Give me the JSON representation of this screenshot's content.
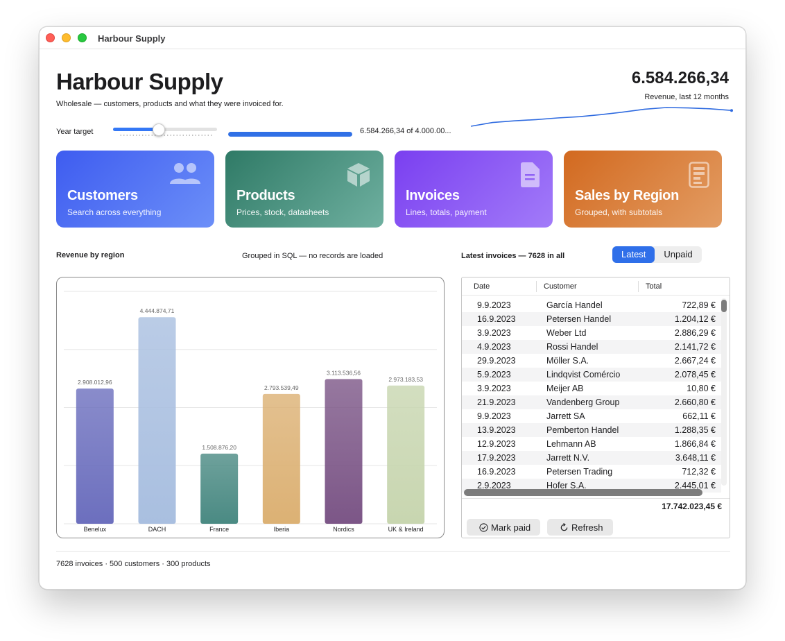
{
  "window": {
    "title": "Harbour Supply"
  },
  "header": {
    "title": "Harbour Supply",
    "subtitle": "Wholesale — customers, products and what they were invoiced for.",
    "revenue_value": "6.584.266,34",
    "revenue_caption": "Revenue, last 12 months"
  },
  "target": {
    "label": "Year target",
    "slider_level": 0.44,
    "progress_fraction": 1.0,
    "progress_text": "6.584.266,34 of 4.000.00..."
  },
  "sparkline": [
    0.1,
    0.28,
    0.36,
    0.42,
    0.5,
    0.56,
    0.66,
    0.78,
    0.92,
    1.0,
    0.98,
    0.94,
    0.86
  ],
  "cards": [
    {
      "title": "Customers",
      "subtitle": "Search across everything",
      "icon": "people-icon"
    },
    {
      "title": "Products",
      "subtitle": "Prices, stock, datasheets",
      "icon": "box-icon"
    },
    {
      "title": "Invoices",
      "subtitle": "Lines, totals, payment",
      "icon": "document-icon"
    },
    {
      "title": "Sales by Region",
      "subtitle": "Grouped, with subtotals",
      "icon": "report-icon"
    }
  ],
  "region_section": {
    "label": "Revenue by region",
    "note": "Grouped in SQL — no records are loaded"
  },
  "chart_data": {
    "type": "bar",
    "categories": [
      "Benelux",
      "DACH",
      "France",
      "Iberia",
      "Nordics",
      "UK & Ireland"
    ],
    "values": [
      2908012.96,
      4444874.71,
      1508876.2,
      2793539.49,
      3113536.56,
      2973183.53
    ],
    "value_labels": [
      "2.908.012,96",
      "4.444.874,71",
      "1.508.876,20",
      "2.793.539,49",
      "3.113.536,56",
      "2.973.183,53"
    ],
    "ylim": [
      0,
      5000000
    ],
    "grid": true,
    "colors": [
      "#6c6fbe",
      "#a9bfe0",
      "#4a8a83",
      "#dcb174",
      "#7c5687",
      "#c8d6b0"
    ]
  },
  "invoices": {
    "label": "Latest invoices — 7628 in all",
    "segments": [
      "Latest",
      "Unpaid"
    ],
    "active_segment": "Latest",
    "columns": [
      "Date",
      "Customer",
      "Total"
    ],
    "rows": [
      [
        "9.9.2023",
        "García Handel",
        "722,89 €"
      ],
      [
        "16.9.2023",
        "Petersen Handel",
        "1.204,12 €"
      ],
      [
        "3.9.2023",
        "Weber Ltd",
        "2.886,29 €"
      ],
      [
        "4.9.2023",
        "Rossi Handel",
        "2.141,72 €"
      ],
      [
        "29.9.2023",
        "Möller S.A.",
        "2.667,24 €"
      ],
      [
        "5.9.2023",
        "Lindqvist Comércio",
        "2.078,45 €"
      ],
      [
        "3.9.2023",
        "Meijer AB",
        "10,80 €"
      ],
      [
        "21.9.2023",
        "Vandenberg Group",
        "2.660,80 €"
      ],
      [
        "9.9.2023",
        "Jarrett SA",
        "662,11 €"
      ],
      [
        "13.9.2023",
        "Pemberton Handel",
        "1.288,35 €"
      ],
      [
        "12.9.2023",
        "Lehmann AB",
        "1.866,84 €"
      ],
      [
        "17.9.2023",
        "Jarrett N.V.",
        "3.648,11 €"
      ],
      [
        "16.9.2023",
        "Petersen Trading",
        "712,32 €"
      ],
      [
        "2.9.2023",
        "Hofer S.A.",
        "2.445,01 €"
      ]
    ],
    "total": "17.742.023,45 €",
    "mark_paid": "Mark paid",
    "refresh": "Refresh"
  },
  "footer": {
    "text": "7628 invoices · 500 customers · 300 products"
  }
}
